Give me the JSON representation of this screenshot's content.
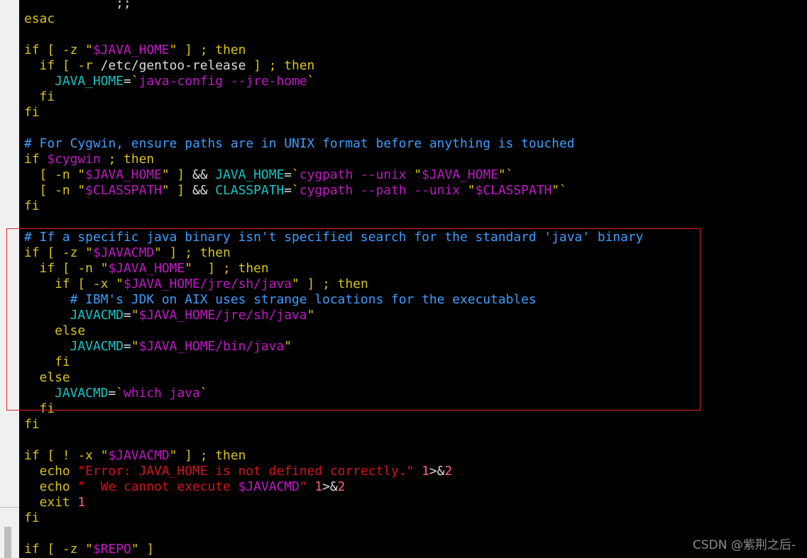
{
  "code_lines": [
    [
      {
        "c": "tx",
        "t": "            ;;"
      }
    ],
    [
      {
        "c": "kw",
        "t": "esac"
      }
    ],
    [],
    [
      {
        "c": "kw",
        "t": "if [ -z \""
      },
      {
        "c": "st",
        "t": "$JAVA_HOME"
      },
      {
        "c": "kw",
        "t": "\" ] ; then"
      }
    ],
    [
      {
        "c": "kw",
        "t": "  if [ -r "
      },
      {
        "c": "tx",
        "t": "/etc/gentoo-release"
      },
      {
        "c": "kw",
        "t": " ] ; then"
      }
    ],
    [
      {
        "c": "vr",
        "t": "    JAVA_HOME"
      },
      {
        "c": "tx",
        "t": "="
      },
      {
        "c": "kw",
        "t": "`"
      },
      {
        "c": "st",
        "t": "java-config --jre-home"
      },
      {
        "c": "kw",
        "t": "`"
      }
    ],
    [
      {
        "c": "kw",
        "t": "  fi"
      }
    ],
    [
      {
        "c": "kw",
        "t": "fi"
      }
    ],
    [],
    [
      {
        "c": "cm",
        "t": "# For Cygwin, ensure paths are in UNIX format before anything is touched"
      }
    ],
    [
      {
        "c": "kw",
        "t": "if "
      },
      {
        "c": "st",
        "t": "$cygwin"
      },
      {
        "c": "kw",
        "t": " ; then"
      }
    ],
    [
      {
        "c": "kw",
        "t": "  [ -n \""
      },
      {
        "c": "st",
        "t": "$JAVA_HOME"
      },
      {
        "c": "kw",
        "t": "\" ] "
      },
      {
        "c": "tx",
        "t": "&&"
      },
      {
        "c": "vr",
        "t": " JAVA_HOME"
      },
      {
        "c": "tx",
        "t": "="
      },
      {
        "c": "kw",
        "t": "`"
      },
      {
        "c": "st",
        "t": "cygpath --unix "
      },
      {
        "c": "kw",
        "t": "\""
      },
      {
        "c": "st",
        "t": "$JAVA_HOME"
      },
      {
        "c": "kw",
        "t": "\"`"
      }
    ],
    [
      {
        "c": "kw",
        "t": "  [ -n \""
      },
      {
        "c": "st",
        "t": "$CLASSPATH"
      },
      {
        "c": "kw",
        "t": "\" ] "
      },
      {
        "c": "tx",
        "t": "&&"
      },
      {
        "c": "vr",
        "t": " CLASSPATH"
      },
      {
        "c": "tx",
        "t": "="
      },
      {
        "c": "kw",
        "t": "`"
      },
      {
        "c": "st",
        "t": "cygpath --path --unix "
      },
      {
        "c": "kw",
        "t": "\""
      },
      {
        "c": "st",
        "t": "$CLASSPATH"
      },
      {
        "c": "kw",
        "t": "\"`"
      }
    ],
    [
      {
        "c": "kw",
        "t": "fi"
      }
    ],
    [],
    [
      {
        "c": "cm",
        "t": "# If a specific java binary isn't specified search for the standard 'java' binary"
      }
    ],
    [
      {
        "c": "kw",
        "t": "if [ -z \""
      },
      {
        "c": "st",
        "t": "$JAVACMD"
      },
      {
        "c": "kw",
        "t": "\" ] ; then"
      }
    ],
    [
      {
        "c": "kw",
        "t": "  if [ -n \""
      },
      {
        "c": "st",
        "t": "$JAVA_HOME"
      },
      {
        "c": "kw",
        "t": "\"  ] ; then"
      }
    ],
    [
      {
        "c": "kw",
        "t": "    if [ -x \""
      },
      {
        "c": "st",
        "t": "$JAVA_HOME/jre/sh/java"
      },
      {
        "c": "kw",
        "t": "\" ] ; then"
      }
    ],
    [
      {
        "c": "cm",
        "t": "      # IBM's JDK on AIX uses strange locations for the executables"
      }
    ],
    [
      {
        "c": "vr",
        "t": "      JAVACMD"
      },
      {
        "c": "tx",
        "t": "="
      },
      {
        "c": "kw",
        "t": "\""
      },
      {
        "c": "st",
        "t": "$JAVA_HOME/jre/sh/java"
      },
      {
        "c": "kw",
        "t": "\""
      }
    ],
    [
      {
        "c": "kw",
        "t": "    else"
      }
    ],
    [
      {
        "c": "vr",
        "t": "      JAVACMD"
      },
      {
        "c": "tx",
        "t": "="
      },
      {
        "c": "kw",
        "t": "\""
      },
      {
        "c": "st",
        "t": "$JAVA_HOME/bin/java"
      },
      {
        "c": "kw",
        "t": "\""
      }
    ],
    [
      {
        "c": "kw",
        "t": "    fi"
      }
    ],
    [
      {
        "c": "kw",
        "t": "  else"
      }
    ],
    [
      {
        "c": "vr",
        "t": "    JAVACMD"
      },
      {
        "c": "tx",
        "t": "="
      },
      {
        "c": "kw",
        "t": "`"
      },
      {
        "c": "st",
        "t": "which java"
      },
      {
        "c": "kw",
        "t": "`"
      }
    ],
    [
      {
        "c": "kw",
        "t": "  fi"
      }
    ],
    [
      {
        "c": "kw",
        "t": "fi"
      }
    ],
    [],
    [
      {
        "c": "kw",
        "t": "if [ ! -x \""
      },
      {
        "c": "st",
        "t": "$JAVACMD"
      },
      {
        "c": "kw",
        "t": "\" ] ; then"
      }
    ],
    [
      {
        "c": "kw",
        "t": "  echo "
      },
      {
        "c": "er",
        "t": "\"Error: JAVA_HOME is not defined correctly.\""
      },
      {
        "c": "nm",
        "t": " 1"
      },
      {
        "c": "tx",
        "t": ">&"
      },
      {
        "c": "nm",
        "t": "2"
      }
    ],
    [
      {
        "c": "kw",
        "t": "  echo "
      },
      {
        "c": "er",
        "t": "\"  We cannot execute "
      },
      {
        "c": "st",
        "t": "$JAVACMD"
      },
      {
        "c": "er",
        "t": "\""
      },
      {
        "c": "nm",
        "t": " 1"
      },
      {
        "c": "tx",
        "t": ">&"
      },
      {
        "c": "nm",
        "t": "2"
      }
    ],
    [
      {
        "c": "kw",
        "t": "  exit "
      },
      {
        "c": "nm",
        "t": "1"
      }
    ],
    [
      {
        "c": "kw",
        "t": "fi"
      }
    ],
    [],
    [
      {
        "c": "kw",
        "t": "if [ -z \""
      },
      {
        "c": "st",
        "t": "$REPO"
      },
      {
        "c": "kw",
        "t": "\" ]"
      }
    ]
  ],
  "watermark": "CSDN @紫荆之后-",
  "colors": {
    "keyword": "#d7c21c",
    "comment": "#3c9dfd",
    "variable": "#12c5c5",
    "string": "#c118c6",
    "error_string": "#d4141c",
    "highlight_box": "#e0242b"
  }
}
